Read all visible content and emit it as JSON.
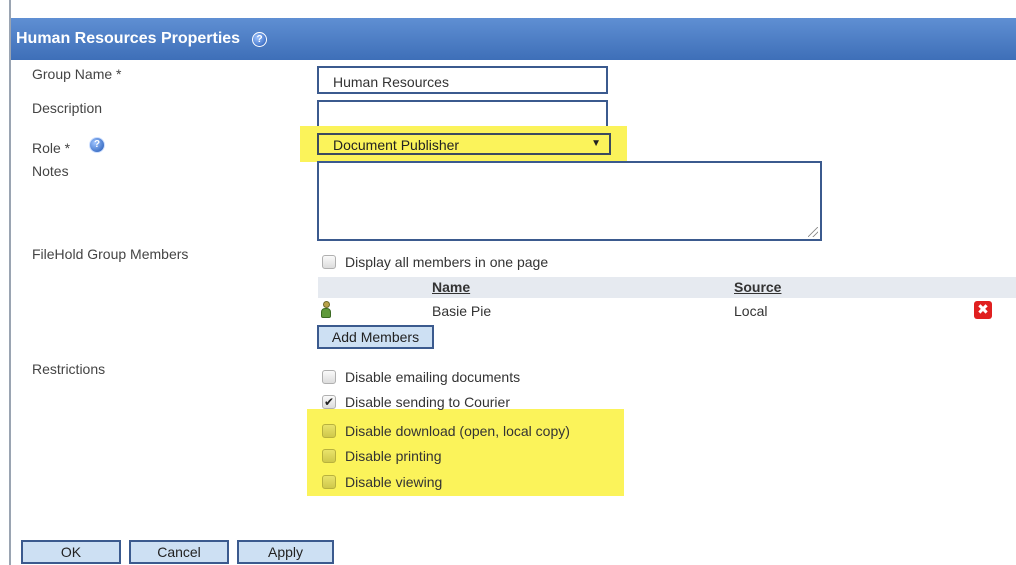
{
  "header": {
    "title": "Human Resources Properties"
  },
  "form": {
    "group_name_label": "Group Name *",
    "group_name_value": "Human Resources",
    "description_label": "Description",
    "description_value": "",
    "role_label": "Role *",
    "role_value": "Document Publisher",
    "notes_label": "Notes",
    "notes_value": ""
  },
  "members": {
    "label": "FileHold Group Members",
    "display_all_label": "Display all members in one page",
    "display_all_checked": false,
    "columns": {
      "name": "Name",
      "source": "Source"
    },
    "rows": [
      {
        "name": "Basie Pie",
        "source": "Local"
      }
    ],
    "add_button": "Add Members"
  },
  "restrictions": {
    "label": "Restrictions",
    "items": [
      {
        "label": "Disable emailing documents",
        "checked": false,
        "highlighted": false
      },
      {
        "label": "Disable sending to Courier",
        "checked": true,
        "highlighted": false
      },
      {
        "label": "Disable download (open, local copy)",
        "checked": false,
        "highlighted": true
      },
      {
        "label": "Disable printing",
        "checked": false,
        "highlighted": true
      },
      {
        "label": "Disable viewing",
        "checked": false,
        "highlighted": true
      }
    ]
  },
  "footer": {
    "ok": "OK",
    "cancel": "Cancel",
    "apply": "Apply"
  },
  "colors": {
    "header_bg": "#4a7cc4",
    "highlight": "#fbf35a",
    "field_border": "#3b5a8e",
    "button_bg": "#cde0f3"
  },
  "icons": {
    "help": "help-icon",
    "user": "user-icon",
    "delete": "delete-icon",
    "dropdown": "chevron-down-icon"
  }
}
